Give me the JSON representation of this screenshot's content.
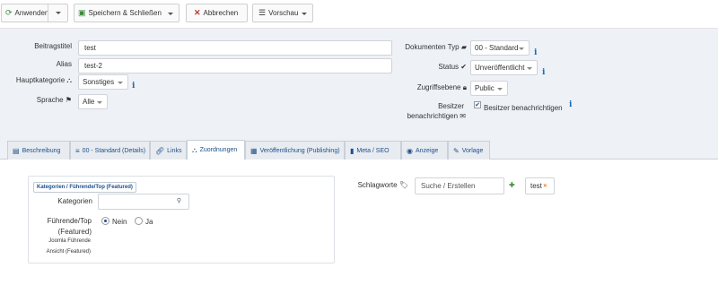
{
  "toolbar": {
    "apply_label": "Anwenden",
    "save_close_label": "Speichern & Schließen",
    "cancel_label": "Abbrechen",
    "preview_label": "Vorschau"
  },
  "form": {
    "title_label": "Beitragstitel",
    "title_value": "test",
    "alias_label": "Alias",
    "alias_value": "test-2",
    "parent_category_label": "Hauptkategorie",
    "parent_category_value": "Sonstiges",
    "language_label": "Sprache",
    "language_value": "Alle",
    "doc_type_label": "Dokumenten Typ",
    "doc_type_value": "00 - Standard",
    "status_label": "Status",
    "status_value": "Unveröffentlicht",
    "access_label": "Zugriffsebene",
    "access_value": "Public",
    "notify_owner_label_1": "Besitzer",
    "notify_owner_label_2": "benachrichtigen",
    "notify_owner_checkbox_label": "Besitzer benachrichtigen",
    "notify_owner_checked": true,
    "info_glyph": "i"
  },
  "tabs": [
    {
      "label": "Beschreibung",
      "icon": "document-icon"
    },
    {
      "label": "00 - Standard (Details)",
      "icon": "stack-icon"
    },
    {
      "label": "Links",
      "icon": "link-icon"
    },
    {
      "label": "Zuordnungen",
      "icon": "sitemap-icon",
      "active": true
    },
    {
      "label": "Veröffentlichung (Publishing)",
      "icon": "calendar-icon"
    },
    {
      "label": "Meta / SEO",
      "icon": "bookmark-icon"
    },
    {
      "label": "Anzeige",
      "icon": "eye-icon"
    },
    {
      "label": "Vorlage",
      "icon": "brush-icon"
    }
  ],
  "assignments": {
    "legend": "Kategorien / Führende/Top (Featured)",
    "categories_label": "Kategorien",
    "categories_value": "",
    "featured_label_1": "Führende/Top",
    "featured_label_2": "(Featured)",
    "featured_desc_1": "Joomla Führende",
    "featured_desc_2": "Ansicht (Featured)",
    "option_no": "Nein",
    "option_yes": "Ja",
    "selected_option": "Nein"
  },
  "tags": {
    "label": "Schlagworte",
    "placeholder": "Suche / Erstellen",
    "chip": "test"
  }
}
